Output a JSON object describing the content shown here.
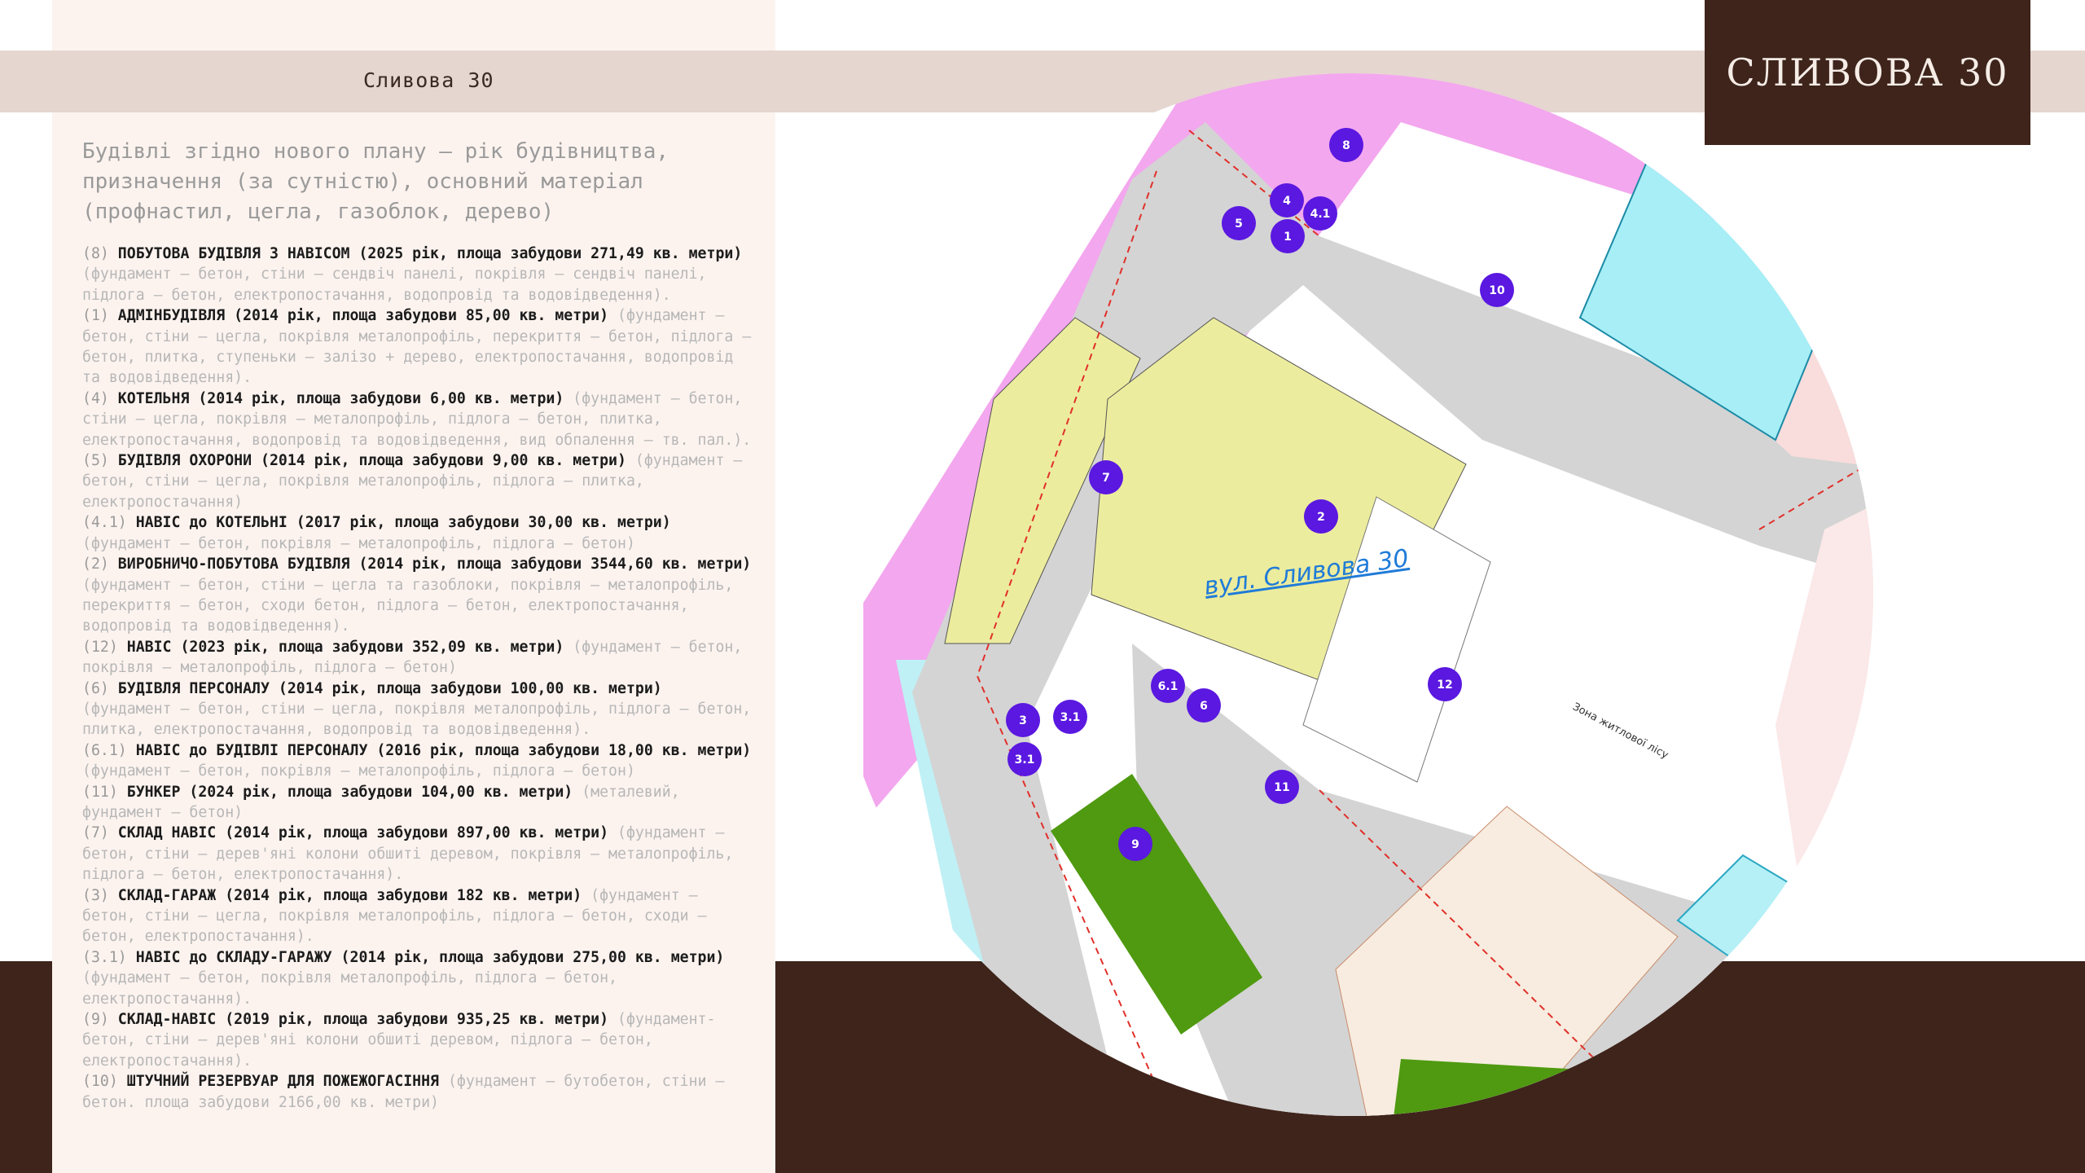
{
  "header": {
    "title": "Сливова 30"
  },
  "brand": {
    "title": "СЛИВОВА 30"
  },
  "intro": "Будівлі згідно нового плану – рік будівництва, призначення (за сутністю), основний матеріал (профнастил, цегла, газоблок, дерево)",
  "buildings": [
    {
      "num": "(8)",
      "head": "ПОБУТОВА БУДІВЛЯ З НАВІСОМ (2025 рік, площа забудови 271,49 кв. метри)",
      "details": "(фундамент – бетон,  стіни – сендвіч панелі, покрівля – сендвіч панелі, підлога – бетон, електропостачання, водопровід та водовідведення)."
    },
    {
      "num": "(1)",
      "head": "АДМІНБУДІВЛЯ (2014 рік, площа забудови 85,00 кв. метри)",
      "details": "(фундамент – бетон, стіни – цегла, покрівля металопрофіль, перекриття – бетон, підлога – бетон, плитка, ступеньки – залізо + дерево, електропостачання, водопровід та водовідведення)."
    },
    {
      "num": "(4)",
      "head": "КОТЕЛЬНЯ (2014 рік, площа забудови 6,00 кв. метри)",
      "details": "(фундамент – бетон, стіни – цегла, покрівля – металопрофіль, підлога – бетон, плитка, електропостачання, водопровід та водовідведення, вид обпалення – тв. пал.)."
    },
    {
      "num": "(5)",
      "head": "БУДІВЛЯ ОХОРОНИ (2014 рік, площа забудови 9,00 кв. метри)",
      "details": "(фундамент – бетон, стіни – цегла, покрівля металопрофіль, підлога – плитка, електропостачання)"
    },
    {
      "num": "(4.1)",
      "head": "НАВІС до КОТЕЛЬНІ (2017 рік, площа забудови 30,00 кв. метри)",
      "details": "(фундамент – бетон, покрівля – металопрофіль, підлога – бетон)"
    },
    {
      "num": "(2)",
      "head": "ВИРОБНИЧО-ПОБУТОВА БУДІВЛЯ (2014 рік, площа забудови 3544,60 кв. метри)",
      "details": "(фундамент – бетон, стіни – цегла та газоблоки, покрівля – металопрофіль, перекриття – бетон,  сходи бетон, підлога – бетон, електропостачання, водопровід та водовідведення)."
    },
    {
      "num": "(12)",
      "head": "НАВІС  (2023 рік, площа забудови 352,09 кв. метри)",
      "details": "(фундамент – бетон, покрівля – металопрофіль, підлога – бетон)"
    },
    {
      "num": "(6)",
      "head": "БУДІВЛЯ ПЕРСОНАЛУ (2014 рік, площа забудови 100,00 кв. метри)",
      "details": "(фундамент – бетон, стіни – цегла, покрівля металопрофіль, підлога – бетон, плитка, електропостачання, водопровід та водовідведення)."
    },
    {
      "num": "(6.1)",
      "head": "НАВІС до БУДІВЛІ ПЕРСОНАЛУ (2016 рік, площа забудови 18,00 кв. метри)",
      "details": "(фундамент – бетон, покрівля – металопрофіль, підлога – бетон)"
    },
    {
      "num": "(11)",
      "head": "БУНКЕР  (2024 рік, площа забудови 104,00 кв. метри)",
      "details": "(металевий, фундамент – бетон)"
    },
    {
      "num": "(7)",
      "head": "СКЛАД НАВІС (2014 рік, площа забудови 897,00 кв. метри)",
      "details": "(фундамент – бетон, стіни – дерев'яні колони обшиті деревом, покрівля – металопрофіль, підлога – бетон, електропостачання)."
    },
    {
      "num": "(3)",
      "head": "СКЛАД-ГАРАЖ (2014 рік, площа забудови 182 кв. метри)",
      "details": "(фундамент – бетон, стіни – цегла, покрівля металопрофіль, підлога – бетон, сходи – бетон, електропостачання)."
    },
    {
      "num": "(3.1)",
      "head": "НАВІС до СКЛАДУ-ГАРАЖУ (2014 рік, площа забудови 275,00 кв. метри)",
      "details": "(фундамент – бетон, покрівля металопрофіль, підлога – бетон, електропостачання)."
    },
    {
      "num": "(9)",
      "head": "СКЛАД-НАВІС (2019 рік, площа забудови 935,25 кв. метри)",
      "details": "(фундамент-бетон, стіни – дерев'яні колони обшиті деревом, підлога – бетон, електропостачання)."
    },
    {
      "num": "(10)",
      "head": "ШТУЧНИЙ РЕЗЕРВУАР ДЛЯ ПОЖЕЖОГАСІННЯ",
      "details": "(фундамент – бутобетон, стіни – бетон. площа забудови 2166,00 кв. метри)"
    }
  ],
  "map": {
    "street_label": "вул. Сливова 30",
    "street_label_edge": "вул.",
    "zone_label": "Зона житлової лісу",
    "markers": [
      "8",
      "4",
      "4.1",
      "5",
      "1",
      "10",
      "7",
      "2",
      "6.1",
      "6",
      "12",
      "3",
      "3.1",
      "3.1",
      "11",
      "9"
    ],
    "colors": {
      "marker": "#5a18e0",
      "pink": "#f3a7ee",
      "pool": "#a7eef6",
      "yellow": "#ecec9e",
      "green": "#4f9a10",
      "road": "#d2d2d2",
      "salmon": "#f9dcdc"
    }
  }
}
